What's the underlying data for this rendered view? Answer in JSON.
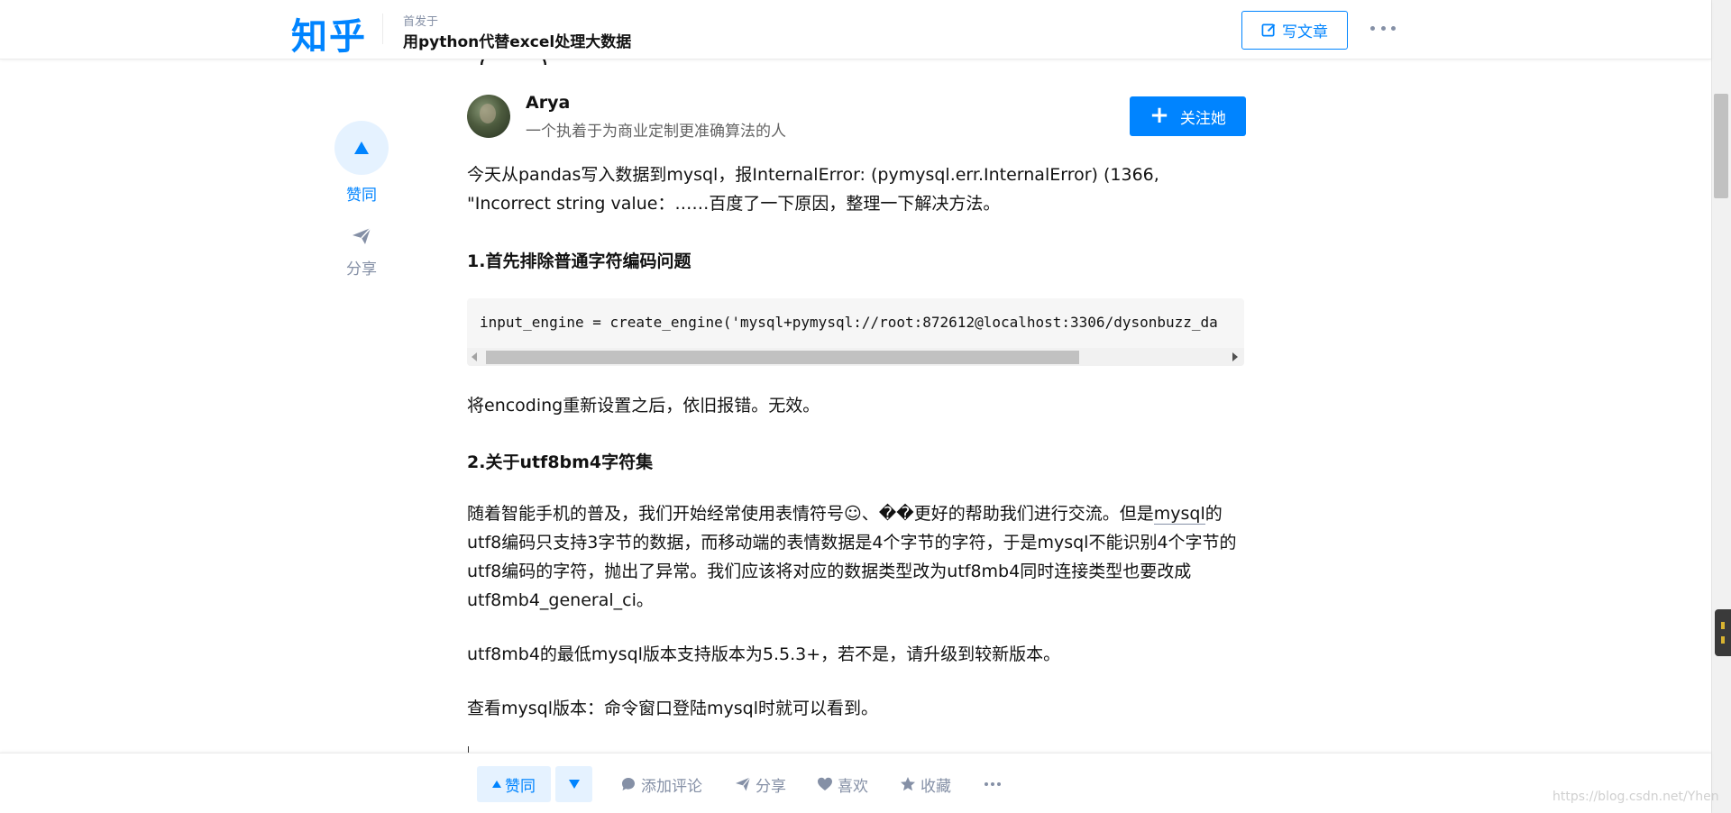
{
  "header": {
    "logo": "知乎",
    "publish_label": "首发于",
    "column_title": "用python代替excel处理大数据",
    "write_button": "写文章",
    "more_icon": "more-dots-icon"
  },
  "sidebar": {
    "vote_label": "赞同",
    "share_label": "分享"
  },
  "author": {
    "name": "Arya",
    "bio": "一个执着于为商业定制更准确算法的人",
    "follow_button": "关注她"
  },
  "article": {
    "intro": "今天从pandas写入数据到mysql，报InternalError: (pymysql.err.InternalError) (1366, \"Incorrect string value：……百度了一下原因，整理一下解决方法。",
    "heading1": "1.首先排除普通字符编码问题",
    "code_line": "input_engine = create_engine('mysql+pymysql://root:872612@localhost:3306/dysonbuzz_da",
    "para2": "将encoding重新设置之后，依旧报错。无效。",
    "heading2": "2.关于utf8bm4字符集",
    "para3_before": "随着智能手机的普及，我们开始经常使用表情符号☺、��更好的帮助我们进行交流。但是",
    "para3_link": "mysql",
    "para3_after": "的utf8编码只支持3字节的数据，而移动端的表情数据是4个字节的字符，于是mysql不能识别4个字节的utf8编码的字符，抛出了异常。我们应该将对应的数据类型改为utf8mb4同时连接类型也要改成utf8mb4_general_ci。",
    "para4": "utf8mb4的最低mysql版本支持版本为5.5.3+，若不是，请升级到较新版本。",
    "para5": "查看mysql版本：命令窗口登陆mysql时就可以看到。"
  },
  "bottom_bar": {
    "upvote": "赞同",
    "comment": "添加评论",
    "share": "分享",
    "like": "喜欢",
    "collect": "收藏"
  },
  "watermark": "https://blog.csdn.net/Yhen",
  "colors": {
    "brand": "#0084ff",
    "brand_light": "#e5f2ff",
    "muted": "#8590a6"
  }
}
